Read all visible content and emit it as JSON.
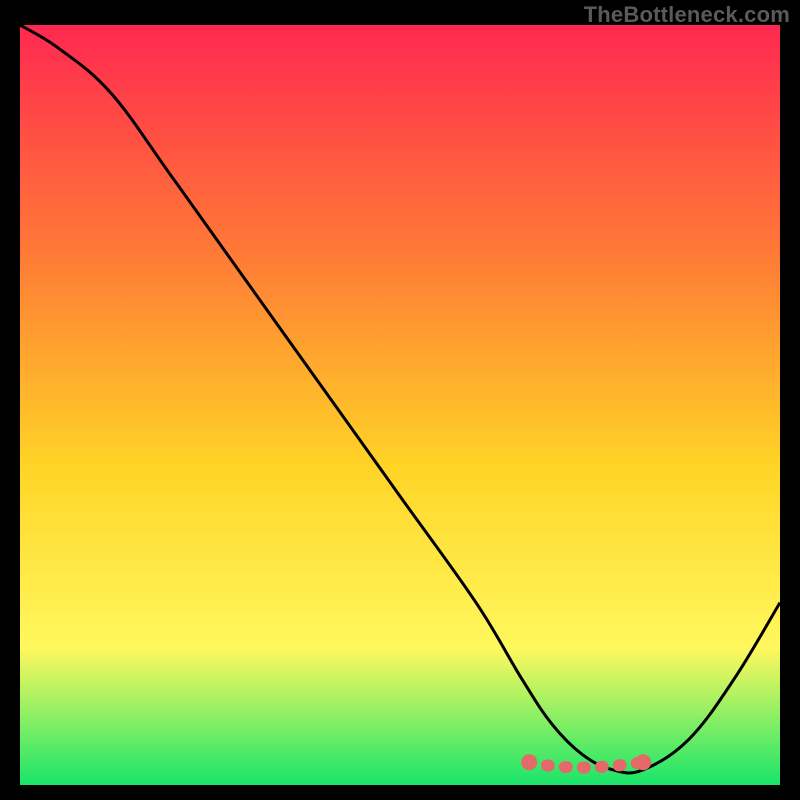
{
  "watermark": "TheBottleneck.com",
  "chart_data": {
    "type": "line",
    "title": "",
    "xlabel": "",
    "ylabel": "",
    "xlim": [
      0,
      100
    ],
    "ylim": [
      0,
      100
    ],
    "grid": false,
    "legend": false,
    "series": [
      {
        "name": "curve",
        "x": [
          0,
          5,
          12,
          20,
          30,
          40,
          50,
          60,
          66,
          70,
          74,
          78,
          82,
          88,
          94,
          100
        ],
        "values": [
          100,
          97,
          91,
          80,
          66,
          52,
          38,
          24,
          14,
          8,
          4,
          2,
          2,
          6,
          14,
          24
        ]
      },
      {
        "name": "optimal-zone",
        "x": [
          67,
          70,
          74,
          78,
          82
        ],
        "values": [
          3.0,
          2.5,
          2.3,
          2.5,
          3.0
        ]
      }
    ],
    "background_gradient": {
      "top": "#ff2850",
      "upper": "#ff7a36",
      "mid": "#ffd426",
      "lower": "#fff85e",
      "bottom": "#19e56a"
    },
    "optimal_marker_color": "#e46a6a",
    "curve_color": "#000000"
  }
}
